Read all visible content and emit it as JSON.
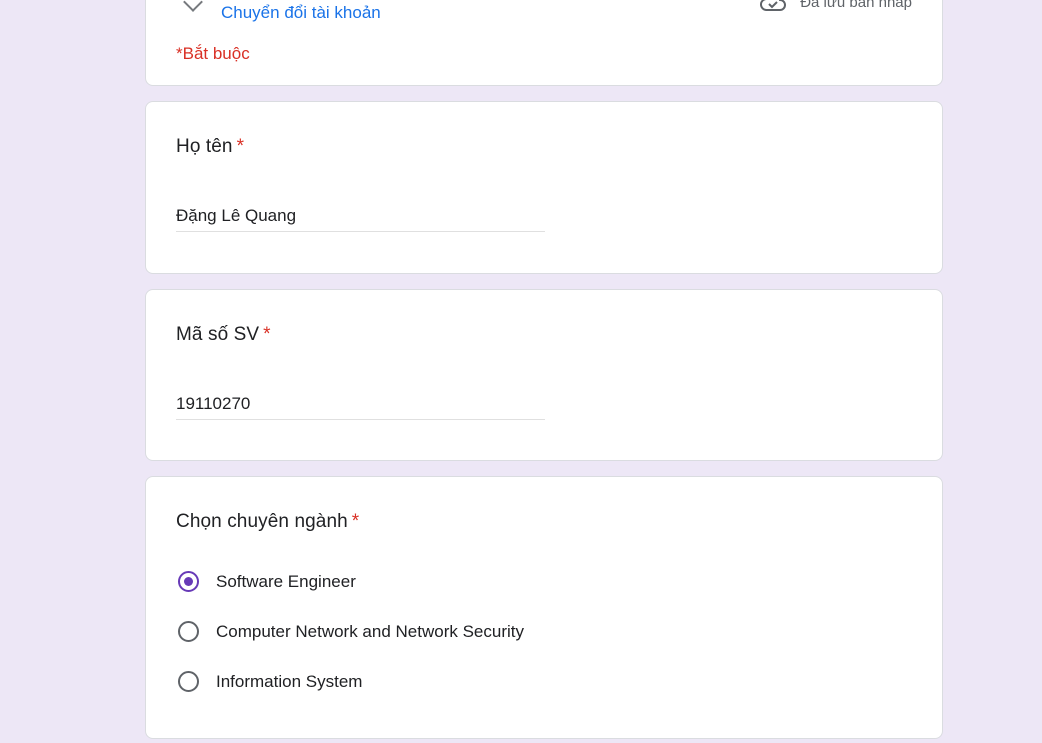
{
  "header": {
    "switch_account_label": "Chuyển đổi tài khoản",
    "saved_draft_text": "Đã lưu bản nháp",
    "required_note": "*Bắt buộc"
  },
  "questions": {
    "name": {
      "title": "Họ tên",
      "required_mark": "*",
      "value": "Đặng Lê Quang"
    },
    "student_id": {
      "title": "Mã số SV",
      "required_mark": "*",
      "value": "19110270"
    },
    "major": {
      "title": "Chọn chuyên ngành",
      "required_mark": "*",
      "options": [
        {
          "label": "Software Engineer",
          "selected": true
        },
        {
          "label": "Computer Network and Network Security",
          "selected": false
        },
        {
          "label": "Information System",
          "selected": false
        }
      ]
    }
  },
  "colors": {
    "background": "#ede7f6",
    "accent": "#673ab7",
    "link": "#1a73e8",
    "required": "#d93025"
  },
  "icons": {
    "saved": "cloud-check-icon",
    "account": "account-icon"
  }
}
